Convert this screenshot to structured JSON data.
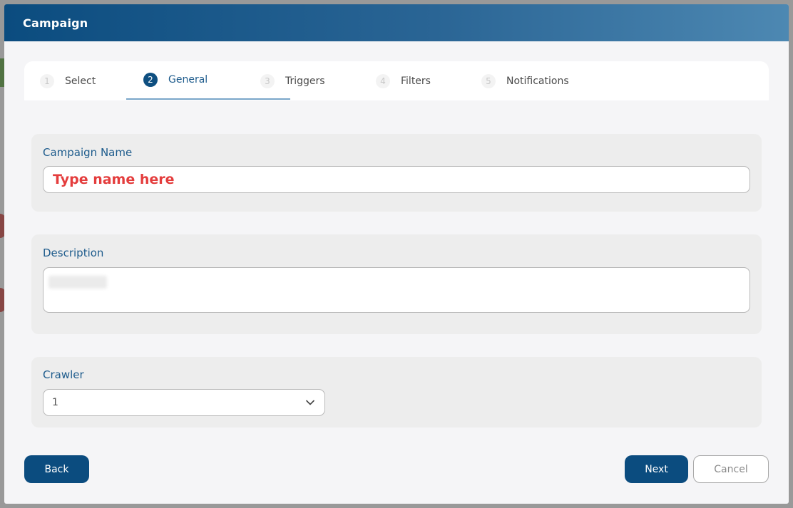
{
  "modal": {
    "title": "Campaign"
  },
  "steps": [
    {
      "num": "1",
      "label": "Select"
    },
    {
      "num": "2",
      "label": "General"
    },
    {
      "num": "3",
      "label": "Triggers"
    },
    {
      "num": "4",
      "label": "Filters"
    },
    {
      "num": "5",
      "label": "Notifications"
    }
  ],
  "active_step": "General",
  "campaign_name": {
    "label": "Campaign Name",
    "placeholder": "Type name here"
  },
  "description": {
    "label": "Description"
  },
  "crawler": {
    "label": "Crawler",
    "value": "1",
    "icon": "chevron-down-icon"
  },
  "buttons": {
    "back": "Back",
    "next": "Next",
    "cancel": "Cancel"
  },
  "colors": {
    "primary": "#0b4c7f",
    "label": "#1d5b8c",
    "placeholder": "#e43d3d"
  }
}
